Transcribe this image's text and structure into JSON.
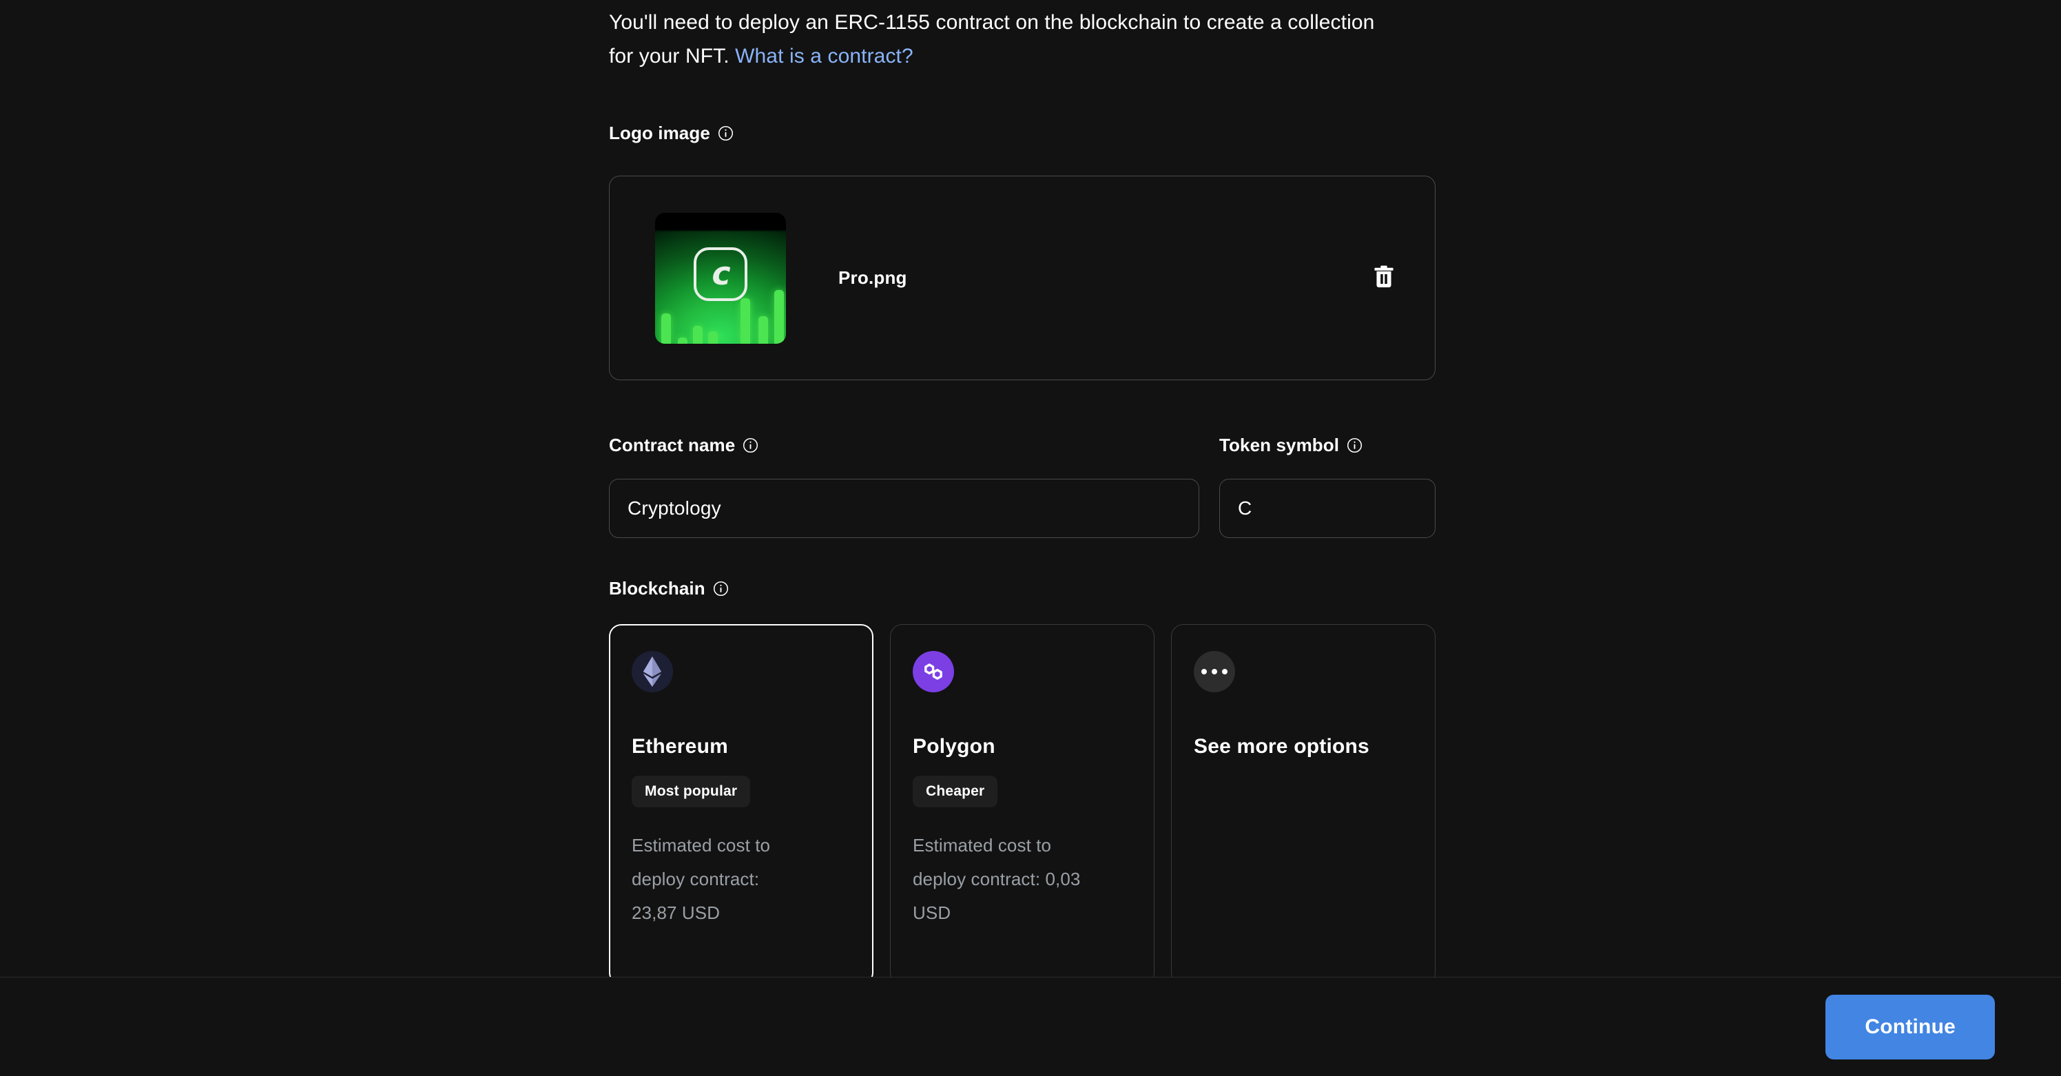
{
  "intro": {
    "text": "You'll need to deploy an ERC-1155 contract on the blockchain to create a collection for your NFT. ",
    "link_text": "What is a contract?"
  },
  "logo": {
    "label": "Logo image",
    "filename": "Pro.png",
    "delete_icon": "trash-icon",
    "info_icon": "info-icon",
    "thumbnail_letter": "c"
  },
  "contract_name": {
    "label": "Contract name",
    "value": "Cryptology",
    "placeholder": "Contract name",
    "info_icon": "info-icon"
  },
  "token_symbol": {
    "label": "Token symbol",
    "value": "C",
    "placeholder": "Token symbol",
    "info_icon": "info-icon"
  },
  "blockchain": {
    "label": "Blockchain",
    "info_icon": "info-icon",
    "cards": [
      {
        "name": "Ethereum",
        "icon": "ethereum-icon",
        "badge": "Most popular",
        "cost_label": "Estimated cost to deploy contract:",
        "cost_value": "23,87 USD",
        "selected": true,
        "accent": "#1d1f35"
      },
      {
        "name": "Polygon",
        "icon": "polygon-icon",
        "badge": "Cheaper",
        "cost_label": "Estimated cost to deploy contract:",
        "cost_value": "0,03 USD",
        "selected": false,
        "accent": "#7b3fe4"
      },
      {
        "name": "See more options",
        "icon": "ellipsis-icon",
        "badge": "",
        "cost_label": "",
        "cost_value": "",
        "selected": false,
        "accent": "#2d2d2d"
      }
    ]
  },
  "footer": {
    "continue_label": "Continue"
  },
  "colors": {
    "background": "#121212",
    "link": "#8ab4f8",
    "primary_button": "#4285e3",
    "muted_text": "#9aa0a6",
    "border": "#4a4a4a",
    "selected_border": "#ffffff"
  }
}
